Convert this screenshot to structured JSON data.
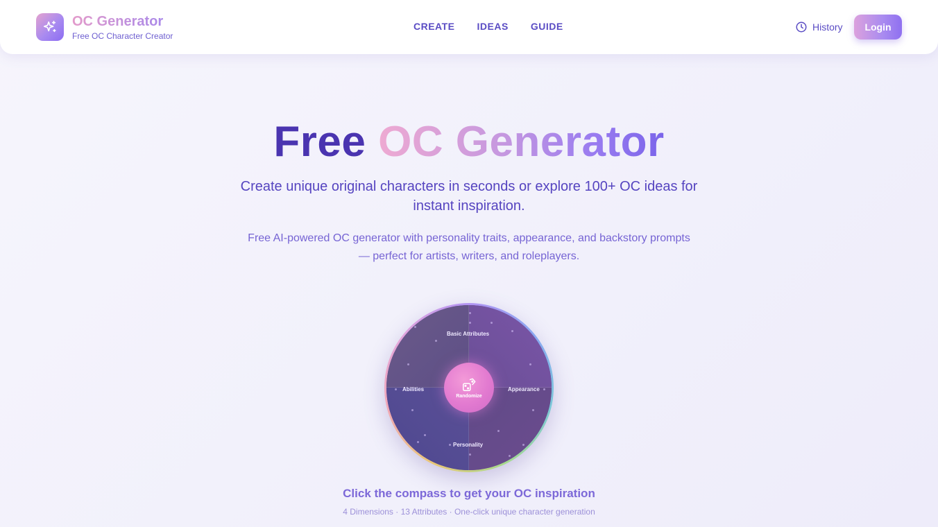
{
  "header": {
    "brand_title": "OC Generator",
    "brand_subtitle": "Free OC Character Creator",
    "logo_icon": "sparkles-icon",
    "nav": [
      {
        "label": "CREATE"
      },
      {
        "label": "IDEAS"
      },
      {
        "label": "GUIDE"
      }
    ],
    "history_label": "History",
    "history_icon": "clock-icon",
    "login_label": "Login"
  },
  "hero": {
    "title_part1": "Free",
    "title_part2": "OC Generator",
    "lead": "Create unique original characters in seconds or explore 100+ OC ideas for instant inspiration.",
    "description": "Free AI-powered OC generator with personality traits, appearance, and backstory prompts — perfect for artists, writers, and roleplayers."
  },
  "compass": {
    "dimensions": {
      "top": "Basic Attributes",
      "right": "Appearance",
      "bottom": "Personality",
      "left": "Abilities"
    },
    "center_label": "Randomize",
    "center_icon": "dice-icon",
    "cta": "Click the compass to get your OC inspiration",
    "cta_sub": "4 Dimensions · 13 Attributes · One-click unique character generation"
  },
  "colors": {
    "primary": "#4a34b0",
    "accent_pink": "#e39bcb",
    "accent_purple": "#9a7cf0"
  }
}
